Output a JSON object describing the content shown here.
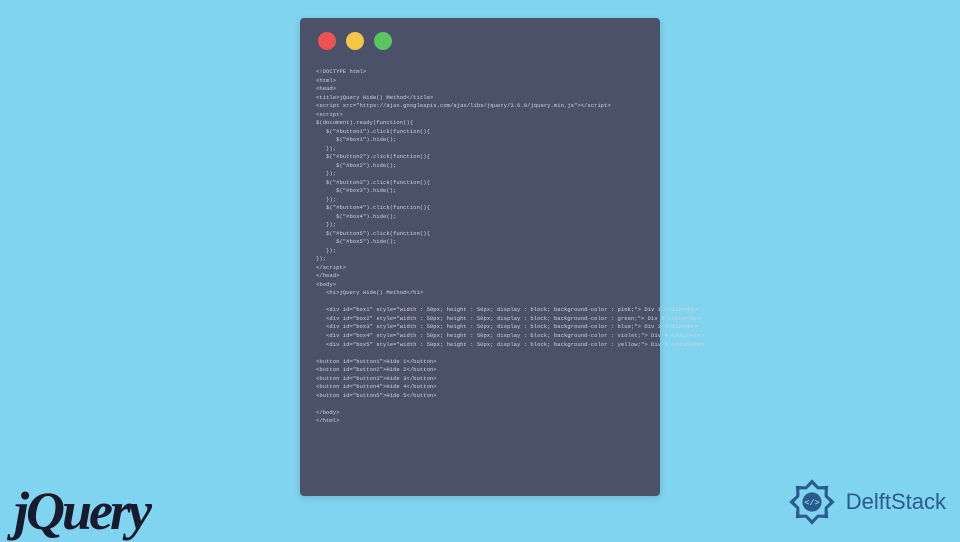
{
  "code_lines": [
    "<!DOCTYPE html>",
    "<html>",
    "<head>",
    "<title>jQuery Hide() Method</title>",
    "<script src=\"https://ajax.googleapis.com/ajax/libs/jquery/3.6.0/jquery.min.js\"></script>",
    "<script>",
    "$(document).ready(function(){",
    "   $(\"#button1\").click(function(){",
    "      $(\"#box1\").hide();",
    "   });",
    "   $(\"#button2\").click(function(){",
    "      $(\"#box2\").hide();",
    "   });",
    "   $(\"#button3\").click(function(){",
    "      $(\"#box3\").hide();",
    "   });",
    "   $(\"#button4\").click(function(){",
    "      $(\"#box4\").hide();",
    "   });",
    "   $(\"#button5\").click(function(){",
    "      $(\"#box5\").hide();",
    "   });",
    "});",
    "</script>",
    "</head>",
    "<body>",
    "   <h1>jQuery Hide() Method</h1>",
    "",
    "   <div id=\"box1\" style=\"width : 50px; height : 50px; display : block; background-color : pink;\"> Div 1 </div><br>",
    "   <div id=\"box2\" style=\"width : 50px; height : 50px; display : block; background-color : green;\"> Div 2 </div><br>",
    "   <div id=\"box3\" style=\"width : 50px; height : 50px; display : block; background-color : blue;\"> Div 3 </div><br>",
    "   <div id=\"box4\" style=\"width : 50px; height : 50px; display : block; background-color : violet;\"> Div 4 </div><br>",
    "   <div id=\"box5\" style=\"width : 50px; height : 50px; display : block; background-color : yellow;\"> Div 5 </div><br>",
    "",
    "<button id=\"button1\">Hide 1</button>",
    "<button id=\"button2\">Hide 2</button>",
    "<button id=\"button3\">Hide 3</button>",
    "<button id=\"button4\">Hide 4</button>",
    "<button id=\"button5\">Hide 5</button>",
    "",
    "</body>",
    "</html>"
  ],
  "logos": {
    "jquery": "jQuery",
    "delftstack": "DelftStack"
  }
}
